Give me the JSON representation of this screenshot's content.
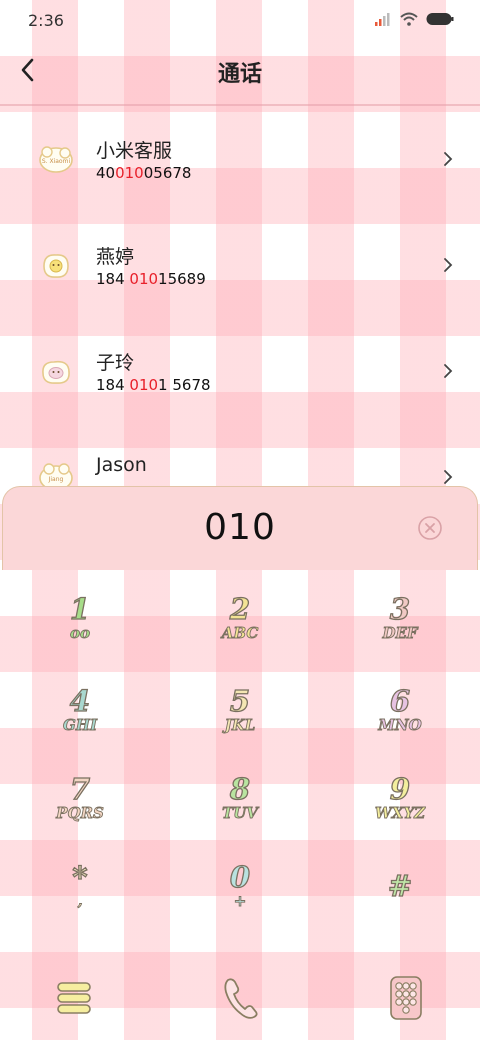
{
  "status_bar": {
    "time": "2:36"
  },
  "header": {
    "title": "通话"
  },
  "results": [
    {
      "name": "小米客服",
      "num_pre": "40",
      "num_hl": "010",
      "num_post": "05678",
      "avatar_text": "S. Xiaomi"
    },
    {
      "name": "燕婷",
      "num_pre": "184 ",
      "num_hl": "010",
      "num_post": "15689",
      "avatar_text": ""
    },
    {
      "name": "子玲",
      "num_pre": "184 ",
      "num_hl": "010",
      "num_post": "1 5678",
      "avatar_text": ""
    },
    {
      "name": "Jason",
      "num_pre": "",
      "num_hl": "",
      "num_post": "",
      "avatar_text": "Jiang"
    }
  ],
  "dial": {
    "number": "010"
  },
  "keypad": [
    {
      "digit": "1",
      "letters": "oo",
      "color": "#a7dd8a"
    },
    {
      "digit": "2",
      "letters": "ABC",
      "color": "#f3e394"
    },
    {
      "digit": "3",
      "letters": "DEF",
      "color": "#f1c9c4"
    },
    {
      "digit": "4",
      "letters": "GHI",
      "color": "#a9d8cf"
    },
    {
      "digit": "5",
      "letters": "JKL",
      "color": "#f4e6b3"
    },
    {
      "digit": "6",
      "letters": "MNO",
      "color": "#e7c3e2"
    },
    {
      "digit": "7",
      "letters": "PQRS",
      "color": "#f3d6c4"
    },
    {
      "digit": "8",
      "letters": "TUV",
      "color": "#b9e4a0"
    },
    {
      "digit": "9",
      "letters": "WXYZ",
      "color": "#f3ee9e"
    },
    {
      "digit": "*",
      "letters": "‚",
      "color": "#f7eac4"
    },
    {
      "digit": "0",
      "letters": "+",
      "color": "#b9e2df"
    },
    {
      "digit": "#",
      "letters": "",
      "color": "#bfe7a8"
    }
  ],
  "colors": {
    "highlight": "#e8202a",
    "panel": "#fbd7d8",
    "accent_pink": "#ffaab4"
  },
  "icons": {
    "menu": "menu-icon",
    "call": "phone-icon",
    "keypad": "dialpad-icon"
  }
}
